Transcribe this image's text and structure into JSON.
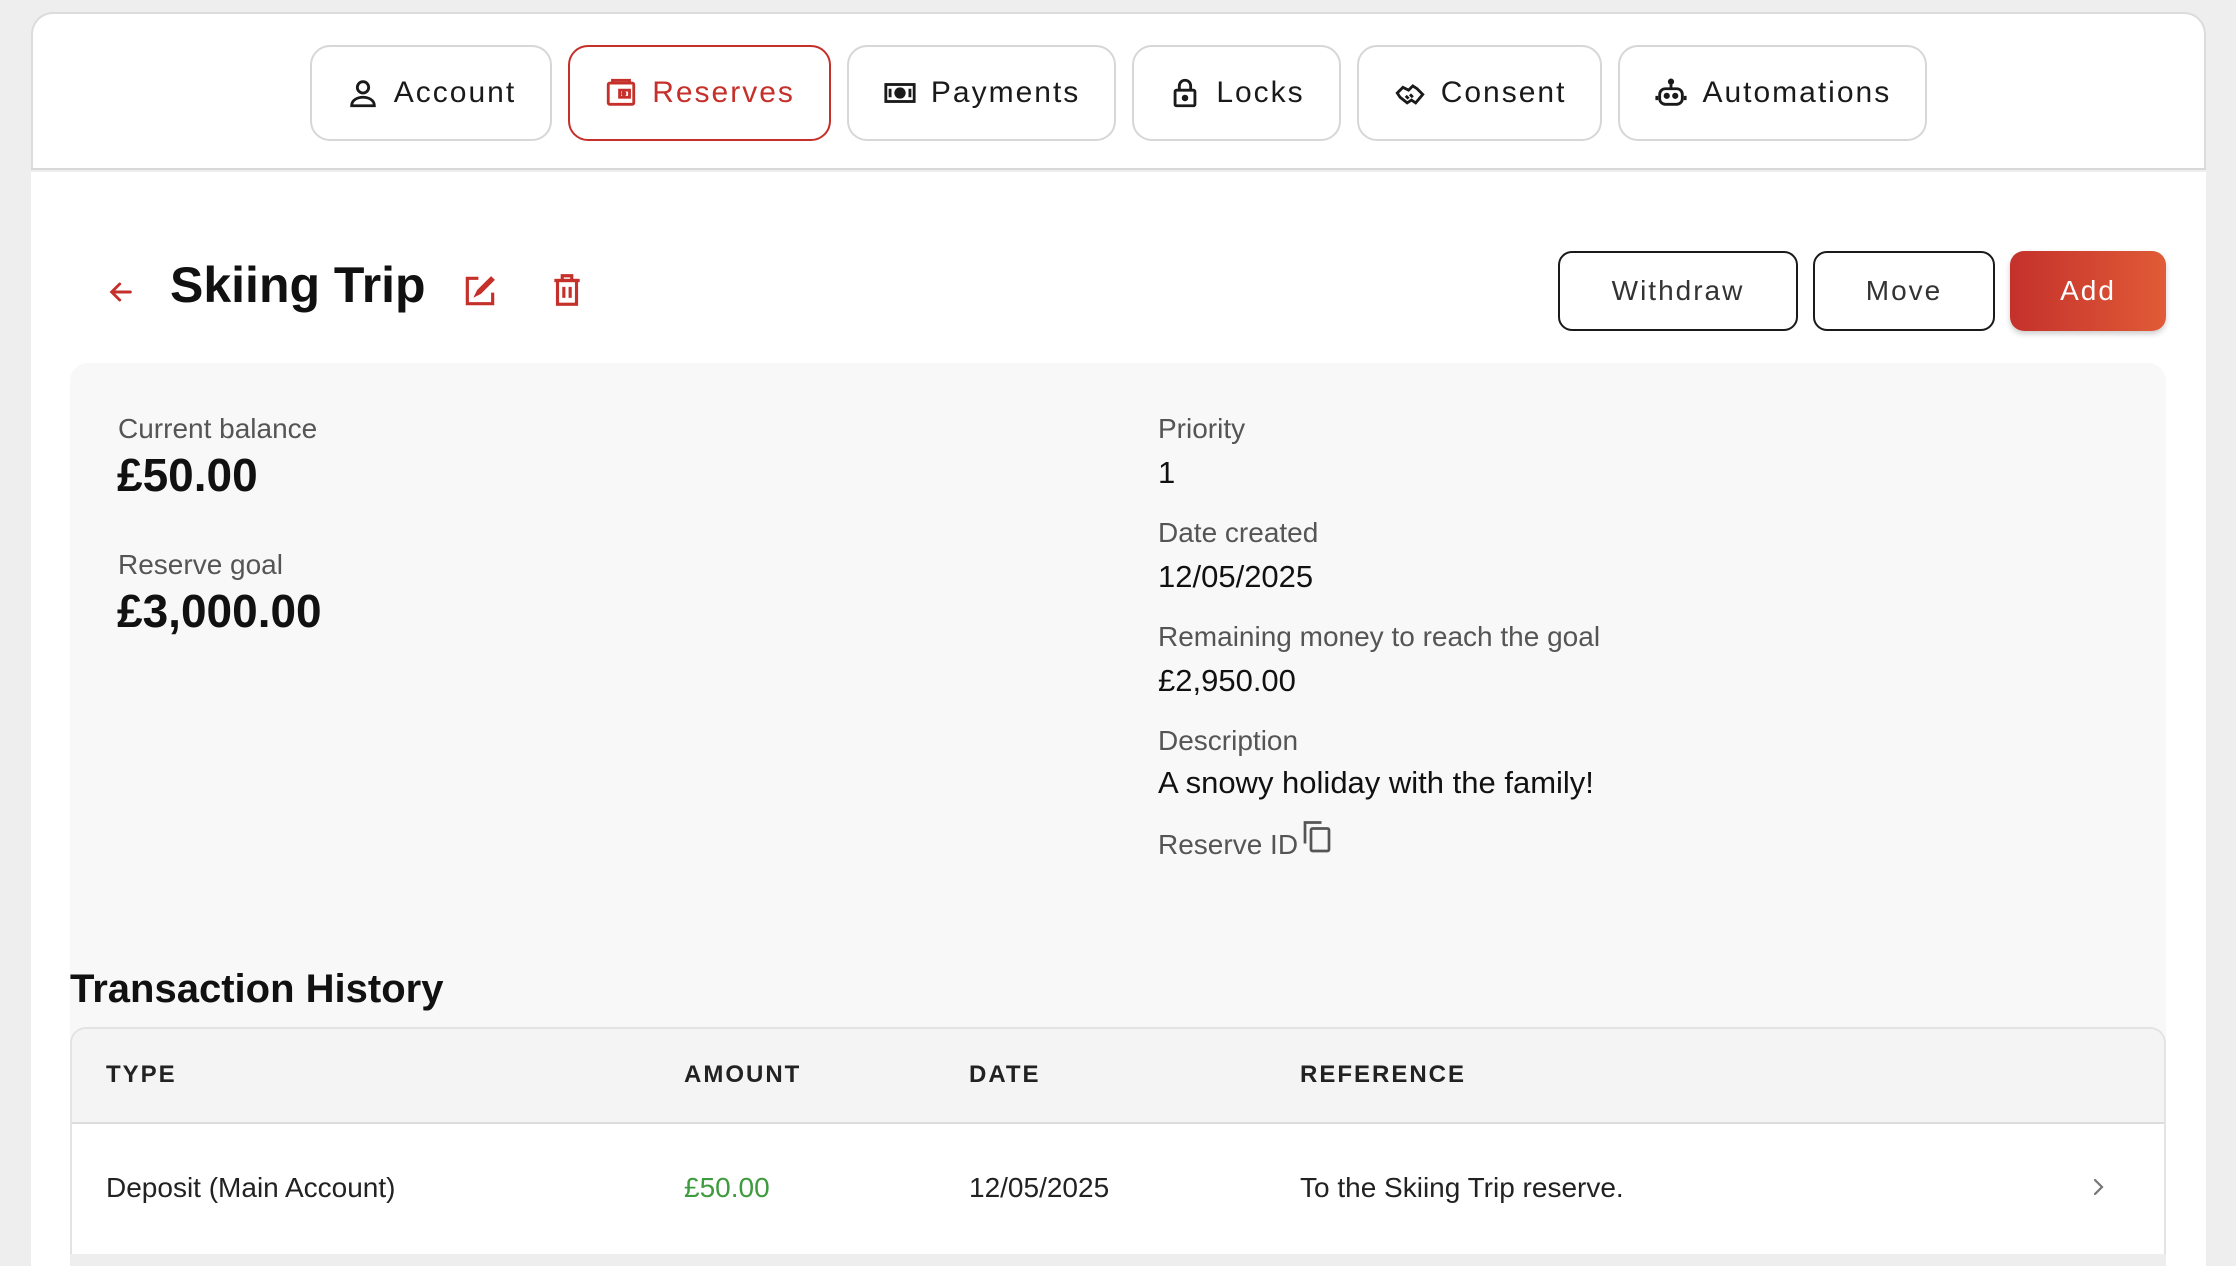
{
  "nav": {
    "tabs": [
      {
        "label": "Account",
        "icon": "user-icon",
        "active": false
      },
      {
        "label": "Reserves",
        "icon": "wallet-icon",
        "active": true
      },
      {
        "label": "Payments",
        "icon": "banknote-icon",
        "active": false
      },
      {
        "label": "Locks",
        "icon": "lock-icon",
        "active": false
      },
      {
        "label": "Consent",
        "icon": "handshake-icon",
        "active": false
      },
      {
        "label": "Automations",
        "icon": "robot-icon",
        "active": false
      }
    ]
  },
  "reserve": {
    "title": "Skiing Trip",
    "actions": {
      "withdraw": "Withdraw",
      "move": "Move",
      "add": "Add"
    },
    "current_balance_label": "Current balance",
    "current_balance": "£50.00",
    "goal_label": "Reserve goal",
    "goal": "£3,000.00",
    "priority_label": "Priority",
    "priority": "1",
    "date_created_label": "Date created",
    "date_created": "12/05/2025",
    "remaining_label": "Remaining money to reach the goal",
    "remaining": "£2,950.00",
    "description_label": "Description",
    "description": "A snowy holiday with the family!",
    "reserve_id_label": "Reserve ID"
  },
  "transactions": {
    "title": "Transaction History",
    "columns": {
      "type": "TYPE",
      "amount": "AMOUNT",
      "date": "DATE",
      "reference": "REFERENCE"
    },
    "rows": [
      {
        "type": "Deposit (Main Account)",
        "amount": "£50.00",
        "date": "12/05/2025",
        "reference": "To the Skiing Trip reserve."
      }
    ]
  },
  "colors": {
    "accent": "#c5302a",
    "positive_amount": "#3e9b3e"
  }
}
